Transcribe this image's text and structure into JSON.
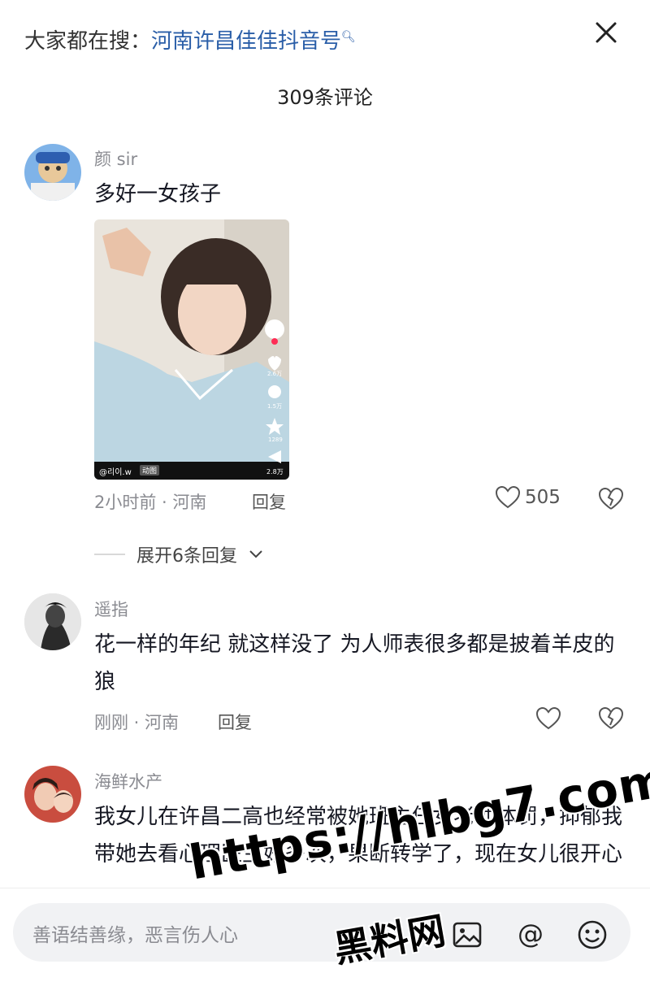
{
  "header": {
    "search_prefix": "大家都在搜：",
    "search_keyword": "河南许昌佳佳抖音号",
    "comment_count": "309条评论"
  },
  "comments": [
    {
      "user": "颜 sir",
      "text": "多好一女孩子",
      "meta": "2小时前 · 河南",
      "reply_label": "回复",
      "likes": "505",
      "image": {
        "handle": "@리이.w",
        "tag": "动图",
        "like_count": "2.6万",
        "comment_count": "1.5万",
        "fav_count": "1289",
        "share_count": "2.8万"
      }
    },
    {
      "user": "遥指",
      "text": "花一样的年纪 就这样没了 为人师表很多都是披着羊皮的狼",
      "meta": "刚刚 · 河南",
      "reply_label": "回复"
    },
    {
      "user": "海鲜水产",
      "text": "我女儿在许昌二高也经常被她班主任女老师体罚，抑郁我带她去看心理医生好多次，果断转学了，现在女儿很开心"
    }
  ],
  "expand_replies": "展开6条回复",
  "input": {
    "placeholder": "善语结善缘，恶言伤人心"
  },
  "watermark": {
    "url": "https://hlbg7.com",
    "name": "黑料网"
  },
  "colors": {
    "keyword": "#2a5ea8",
    "muted": "#8a8b91"
  }
}
